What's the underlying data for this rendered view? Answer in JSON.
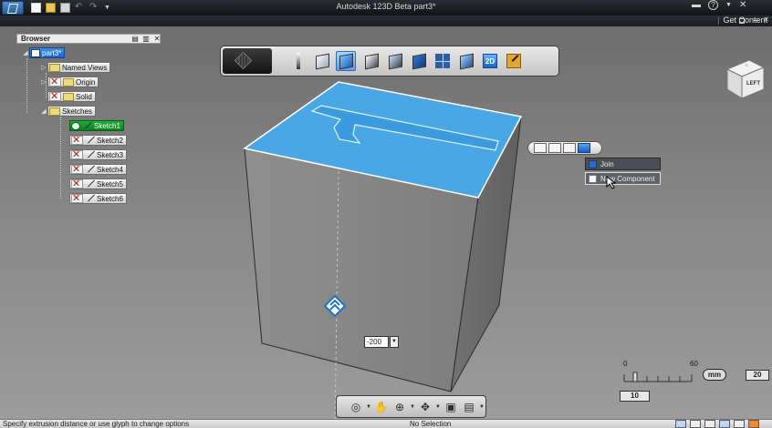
{
  "window": {
    "title": "Autodesk 123D Beta    part3*",
    "get_content": "Get Content",
    "colors": {
      "titlebar": "#1b1d21",
      "accent_blue": "#3b9be0",
      "active_green": "#1a9a36"
    }
  },
  "quick_access": [
    "new-icon",
    "open-icon",
    "save-icon",
    "undo-icon",
    "redo-icon",
    "dropdown-icon"
  ],
  "browser": {
    "title": "Browser",
    "root": "part3*",
    "items": [
      {
        "label": "Named Views"
      },
      {
        "label": "Origin"
      },
      {
        "label": "Solid"
      },
      {
        "label": "Sketches"
      }
    ],
    "sketches": [
      "Sketch1",
      "Sketch2",
      "Sketch3",
      "Sketch4",
      "Sketch5",
      "Sketch6"
    ]
  },
  "toolbar": {
    "tools": [
      "box-primitive-icon",
      "pencil-icon",
      "primitives-icon",
      "sketch-extrude-icon",
      "construct-icon",
      "modify-icon",
      "combine-icon",
      "pattern-icon",
      "grouping-icon",
      "sketch-2d-icon",
      "sketch-tool-icon"
    ],
    "sketch_2d_label": "2D"
  },
  "operation": {
    "menu": [
      "Join",
      "New Component"
    ]
  },
  "extrude": {
    "distance_value": "-200"
  },
  "viewcube": {
    "face_label": "LEFT"
  },
  "ruler": {
    "min_label": "0",
    "max_label": "60",
    "unit": "mm",
    "scale_value": "20",
    "grid_value": "10"
  },
  "status": {
    "prompt": "Specify extrusion distance or use glyph to change options",
    "selection": "No Selection"
  }
}
